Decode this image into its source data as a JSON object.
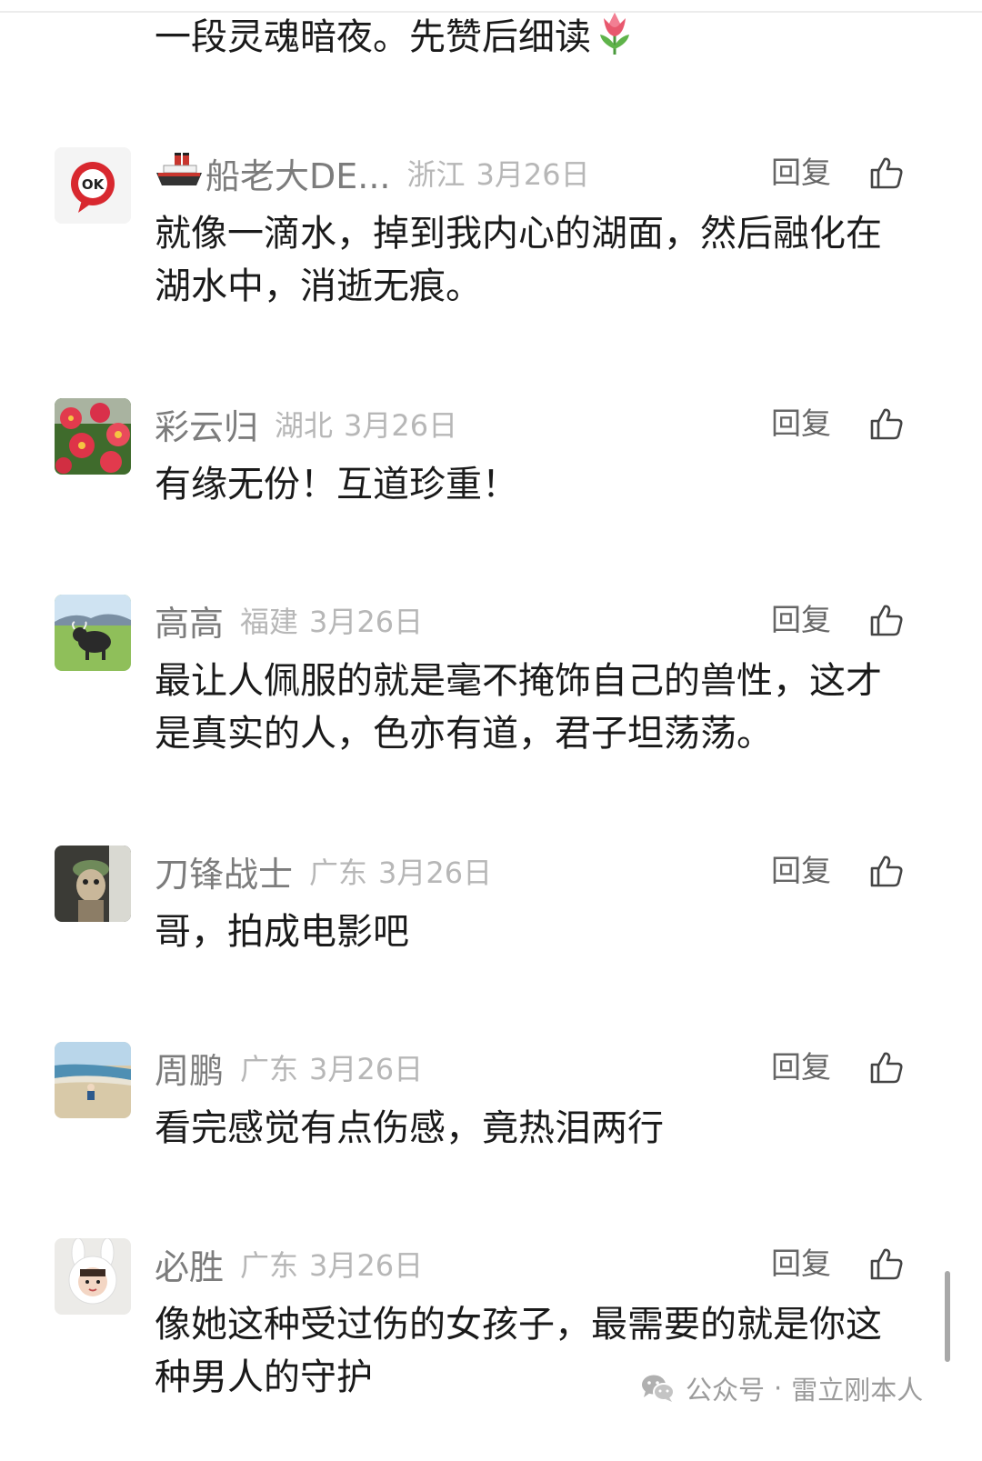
{
  "partial_comment": {
    "text": "一段灵魂暗夜。先赞后细读",
    "emoji": "tulip"
  },
  "comments": [
    {
      "nickname": "船老大DE...",
      "nickname_icon": "ship-icon",
      "location": "浙江",
      "date": "3月26日",
      "reply_label": "回复",
      "text": "就像一滴水，掉到我内心的湖面，然后融化在湖水中，消逝无痕。",
      "avatar": "ok-logo-avatar"
    },
    {
      "nickname": "彩云归",
      "location": "湖北",
      "date": "3月26日",
      "reply_label": "回复",
      "text": "有缘无份！互道珍重！",
      "avatar": "red-flowers-avatar"
    },
    {
      "nickname": "高高",
      "location": "福建",
      "date": "3月26日",
      "reply_label": "回复",
      "text": "最让人佩服的就是毫不掩饰自己的兽性，这才是真实的人，色亦有道，君子坦荡荡。",
      "avatar": "yak-grassland-avatar"
    },
    {
      "nickname": "刀锋战士",
      "location": "广东",
      "date": "3月26日",
      "reply_label": "回复",
      "text": "哥，拍成电影吧",
      "avatar": "cartoon-character-avatar"
    },
    {
      "nickname": "周鹏",
      "location": "广东",
      "date": "3月26日",
      "reply_label": "回复",
      "text": "看完感觉有点伤感，竟热泪两行",
      "avatar": "beach-avatar"
    },
    {
      "nickname": "必胜",
      "location": "广东",
      "date": "3月26日",
      "reply_label": "回复",
      "text": "像她这种受过伤的女孩子，最需要的就是你这种男人的守护",
      "avatar": "child-bunny-hood-avatar"
    }
  ],
  "watermark": {
    "prefix": "公众号",
    "separator": "·",
    "account": "雷立刚本人",
    "icon": "wechat-icon"
  },
  "colors": {
    "nickname": "#7c7c7c",
    "meta": "#b7b7b7",
    "text": "#1a1a1a",
    "reply": "#666666"
  }
}
